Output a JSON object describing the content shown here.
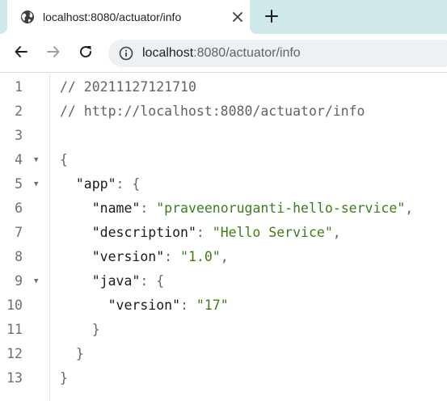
{
  "browser": {
    "tab_title": "localhost:8080/actuator/info",
    "url_host": "localhost",
    "url_rest": ":8080/actuator/info"
  },
  "viewer": {
    "lines": [
      {
        "num": "1",
        "fold": "",
        "indent": "",
        "comment": "// 20211127121710"
      },
      {
        "num": "2",
        "fold": "",
        "indent": "",
        "comment": "// http://localhost:8080/actuator/info"
      },
      {
        "num": "3",
        "fold": "",
        "indent": ""
      },
      {
        "num": "4",
        "fold": "▼",
        "indent": "",
        "punc": "{"
      },
      {
        "num": "5",
        "fold": "▼",
        "indent": "  ",
        "key": "\"app\"",
        "punc": ": {"
      },
      {
        "num": "6",
        "fold": "",
        "indent": "    ",
        "key": "\"name\"",
        "sep": ": ",
        "str": "\"praveenoruganti-hello-service\"",
        "tail": ","
      },
      {
        "num": "7",
        "fold": "",
        "indent": "    ",
        "key": "\"description\"",
        "sep": ": ",
        "str": "\"Hello Service\"",
        "tail": ","
      },
      {
        "num": "8",
        "fold": "",
        "indent": "    ",
        "key": "\"version\"",
        "sep": ": ",
        "str": "\"1.0\"",
        "tail": ","
      },
      {
        "num": "9",
        "fold": "▼",
        "indent": "    ",
        "key": "\"java\"",
        "punc": ": {"
      },
      {
        "num": "10",
        "fold": "",
        "indent": "      ",
        "key": "\"version\"",
        "sep": ": ",
        "str": "\"17\""
      },
      {
        "num": "11",
        "fold": "",
        "indent": "    ",
        "punc": "}"
      },
      {
        "num": "12",
        "fold": "",
        "indent": "  ",
        "punc": "}"
      },
      {
        "num": "13",
        "fold": "",
        "indent": "",
        "punc": "}"
      }
    ]
  },
  "colors": {
    "tabstrip": "#cfe8e9",
    "string": "#3c7d1a",
    "comment": "#5f6368"
  }
}
